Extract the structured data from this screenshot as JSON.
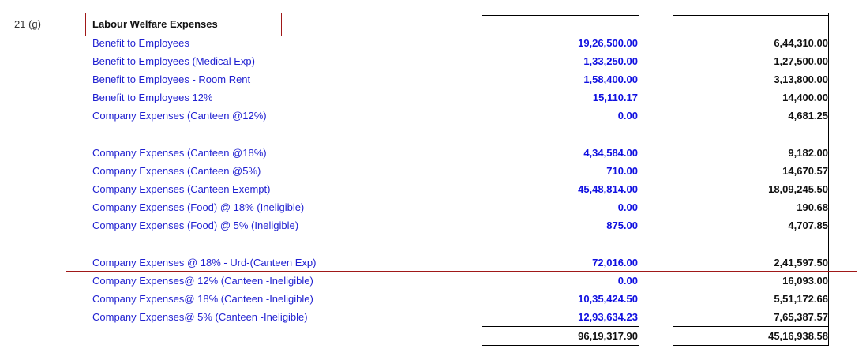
{
  "note": {
    "ref": "21 (g)"
  },
  "section": {
    "title": "Labour Welfare Expenses"
  },
  "rows": [
    {
      "label": "Benefit to Employees",
      "current": "19,26,500.00",
      "previous": "6,44,310.00"
    },
    {
      "label": "Benefit to Employees (Medical Exp)",
      "current": "1,33,250.00",
      "previous": "1,27,500.00"
    },
    {
      "label": "Benefit to Employees - Room Rent",
      "current": "1,58,400.00",
      "previous": "3,13,800.00"
    },
    {
      "label": "Benefit to Employees 12%",
      "current": "15,110.17",
      "previous": "14,400.00"
    },
    {
      "label": "Company Expenses (Canteen @12%)",
      "current": "0.00",
      "previous": "4,681.25"
    },
    {
      "label": "Company Expenses (Canteen @18%)",
      "current": "4,34,584.00",
      "previous": "9,182.00"
    },
    {
      "label": "Company Expenses (Canteen @5%)",
      "current": "710.00",
      "previous": "14,670.57"
    },
    {
      "label": "Company Expenses (Canteen Exempt)",
      "current": "45,48,814.00",
      "previous": "18,09,245.50"
    },
    {
      "label": "Company Expenses (Food) @ 18% (Ineligible)",
      "current": "0.00",
      "previous": "190.68"
    },
    {
      "label": "Company Expenses (Food) @ 5% (Ineligible)",
      "current": "875.00",
      "previous": "4,707.85"
    },
    {
      "label": "Company Expenses @ 18% - Urd-(Canteen Exp)",
      "current": "72,016.00",
      "previous": "2,41,597.50"
    },
    {
      "label": "Company Expenses@ 12% (Canteen -Ineligible)",
      "current": "0.00",
      "previous": "16,093.00"
    },
    {
      "label": "Company Expenses@ 18% (Canteen -Ineligible)",
      "current": "10,35,424.50",
      "previous": "5,51,172.66"
    },
    {
      "label": "Company Expenses@ 5% (Canteen -Ineligible)",
      "current": "12,93,634.23",
      "previous": "7,65,387.57"
    }
  ],
  "totals": {
    "current": "96,19,317.90",
    "previous": "45,16,938.58"
  },
  "colors": {
    "label": "#1f1fd0",
    "current_amount": "#1010e0",
    "previous_amount": "#111111",
    "highlight_box": "#a01818"
  }
}
